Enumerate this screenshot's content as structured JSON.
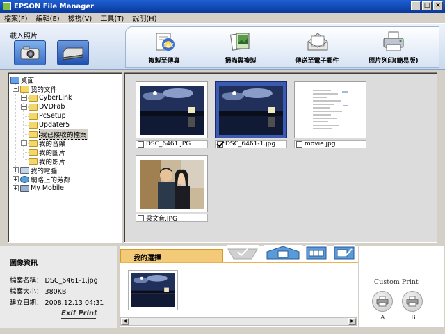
{
  "window": {
    "title": "EPSON File Manager"
  },
  "menu": [
    "檔案(F)",
    "編輯(E)",
    "檢視(V)",
    "工具(T)",
    "說明(H)"
  ],
  "load": {
    "label": "載入照片"
  },
  "tools": [
    {
      "label": "複製至傳真",
      "icon": "fax-icon"
    },
    {
      "label": "掃瞄與複製",
      "icon": "scan-copy-icon"
    },
    {
      "label": "傳送至電子郵件",
      "icon": "email-icon"
    },
    {
      "label": "照片列印(簡易版)",
      "icon": "printer-icon"
    }
  ],
  "tree": {
    "desktop": "桌面",
    "my_documents": "我的文件",
    "children": [
      "CyberLink",
      "DVDFab",
      "PcSetup",
      "Updater5",
      "我已接收的檔案",
      "我的音樂",
      "我的圖片",
      "我的影片"
    ],
    "my_computer": "我的電腦",
    "network": "網路上的芳鄰",
    "my_mobile": "My Mobile"
  },
  "thumbnails": [
    {
      "name": "DSC_6461.JPG",
      "checked": false,
      "selected": false,
      "kind": "night"
    },
    {
      "name": "DSC_6461-1.jpg",
      "checked": true,
      "selected": true,
      "kind": "night"
    },
    {
      "name": "movie.jpg",
      "checked": false,
      "selected": false,
      "kind": "doc"
    },
    {
      "name": "梁文音.JPG",
      "checked": false,
      "selected": false,
      "kind": "people"
    }
  ],
  "image_info": {
    "heading": "圖像資訊",
    "name_label": "檔案名稱：",
    "name_value": "DSC_6461-1.jpg",
    "size_label": "檔案大小：",
    "size_value": "380KB",
    "date_label": "建立日期：",
    "date_value": "2008.12.13 04:31",
    "exif_logo": "Exif Print"
  },
  "selection": {
    "tab_label": "我的選擇"
  },
  "custom_print": {
    "title": "Custom Print",
    "a_label": "A",
    "b_label": "B"
  },
  "colors": {
    "accent": "#1f5fd4",
    "tab": "#f3ca78",
    "selected_frame": "#3a5bb0"
  }
}
